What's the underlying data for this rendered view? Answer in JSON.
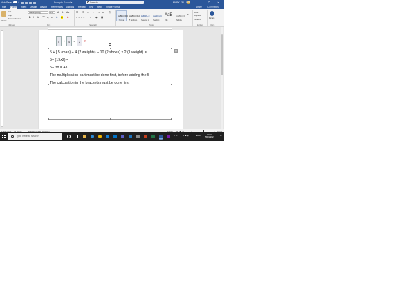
{
  "titlebar": {
    "autosave_label": "AutoSave",
    "autosave_state": "On",
    "doc_title": "Prompt • Saved ▾",
    "search_placeholder": "Search",
    "user_name": "MARK KELLSS",
    "user_initials": "MK",
    "window_controls": [
      "—",
      "❐",
      "✕"
    ]
  },
  "tabs": [
    "File",
    "Home",
    "Insert",
    "Design",
    "Layout",
    "References",
    "Mailings",
    "Review",
    "View",
    "Help",
    "Shape Format"
  ],
  "active_tab": "Home",
  "share_label": "Share",
  "comments_label": "Comments",
  "ribbon": {
    "clipboard": {
      "paste": "Paste",
      "cut": "Cut",
      "copy": "Copy",
      "format_painter": "Format Painter",
      "group": "Clipboard"
    },
    "font": {
      "family": "Calibri (Body)",
      "size": "11",
      "group": "Font",
      "buttons": [
        "B",
        "I",
        "U",
        "abc",
        "x₂",
        "x²",
        "A",
        "ab",
        "A"
      ]
    },
    "paragraph": {
      "group": "Paragraph",
      "buttons": [
        "☰",
        "☷",
        "≡",
        "⇤",
        "⇥",
        "A↓",
        "¶"
      ]
    },
    "styles": {
      "group": "Styles",
      "items": [
        {
          "preview": "AaBbCcDd",
          "name": "¶ Normal"
        },
        {
          "preview": "AaBbCcDd",
          "name": "¶ No Spac..."
        },
        {
          "preview": "AaBbCc",
          "name": "Heading 1"
        },
        {
          "preview": "AaBbCcC",
          "name": "Heading 2"
        },
        {
          "preview": "AaB",
          "name": "Title"
        },
        {
          "preview": "AaBbCcD",
          "name": "Subtitle"
        }
      ]
    },
    "editing": {
      "find": "Find ▾",
      "replace": "Replace",
      "select": "Select ▾",
      "group": "Editing"
    },
    "voice": {
      "dictate": "Dictate",
      "group": "Voice"
    }
  },
  "document": {
    "lines": [
      "5 + [ 5 (man) + 4 (2 weights) + 10 (2 shoes) x 2 (1 weight) =",
      "5+ (19x2) =",
      "5+ 38 = 43",
      "The multiplication part must be done first, before adding the 5",
      "The calculation in the brackets must be done first"
    ],
    "equation_glyphs": [
      "5",
      "+",
      "4",
      "x",
      "2",
      "?"
    ]
  },
  "status": {
    "page": "Page 1 of 1",
    "words": "49 words",
    "language": "English (United Kingdom)",
    "focus": "Focus",
    "zoom": "100%"
  },
  "taskbar": {
    "search_placeholder": "Type here to search",
    "tray_temp": "7°C",
    "lang": "ENG",
    "time": "17:13",
    "date": "25/01/2021"
  },
  "colors": {
    "word_blue": "#2b579a",
    "taskbar": "#202020"
  }
}
